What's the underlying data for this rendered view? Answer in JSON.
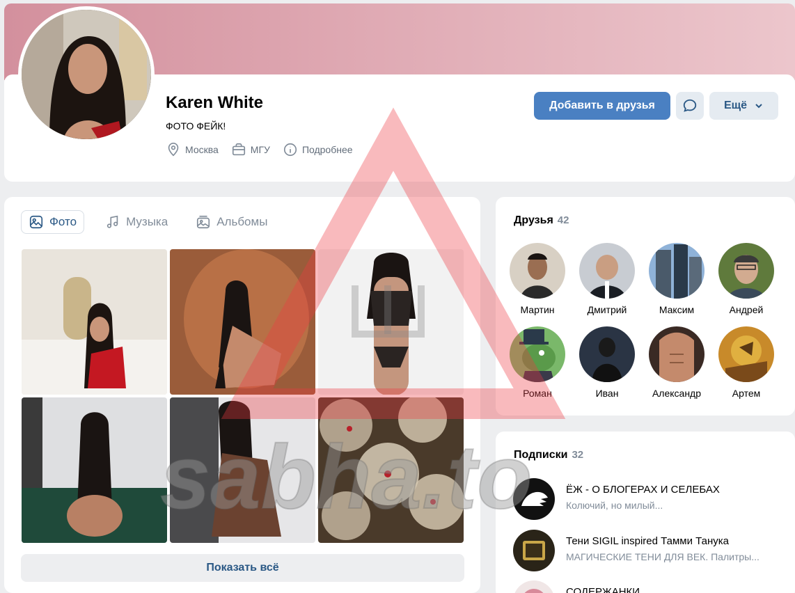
{
  "profile": {
    "name": "Karen White",
    "status": "ФОТО ФЕЙК!",
    "location": "Москва",
    "education": "МГУ",
    "details": "Подробнее"
  },
  "actions": {
    "add_friend": "Добавить в друзья",
    "more": "Ещё"
  },
  "photos_tabs": [
    {
      "label": "Фото",
      "active": true
    },
    {
      "label": "Музыка",
      "active": false
    },
    {
      "label": "Альбомы",
      "active": false
    }
  ],
  "show_all": "Показать всё",
  "friends": {
    "title": "Друзья",
    "count": "42",
    "items": [
      {
        "name": "Мартин"
      },
      {
        "name": "Дмитрий"
      },
      {
        "name": "Максим"
      },
      {
        "name": "Андрей"
      },
      {
        "name": "Роман"
      },
      {
        "name": "Иван"
      },
      {
        "name": "Александр"
      },
      {
        "name": "Артем"
      }
    ]
  },
  "subscriptions": {
    "title": "Подписки",
    "count": "32",
    "items": [
      {
        "name": "ЁЖ - О БЛОГЕРАХ И СЕЛЕБАХ",
        "desc": "Колючий, но милый..."
      },
      {
        "name": "Тени SIGIL inspired Тамми Танука",
        "desc": "МАГИЧЕСКИЕ ТЕНИ ДЛЯ ВЕК. Палитры..."
      },
      {
        "name": "СОДЕРЖАНКИ",
        "desc": ""
      }
    ]
  },
  "watermark": {
    "text": "sabha.to",
    "color": "#e0202a"
  },
  "colors": {
    "accent": "#4a80c2",
    "link": "#2a5885",
    "muted": "#818c99"
  }
}
